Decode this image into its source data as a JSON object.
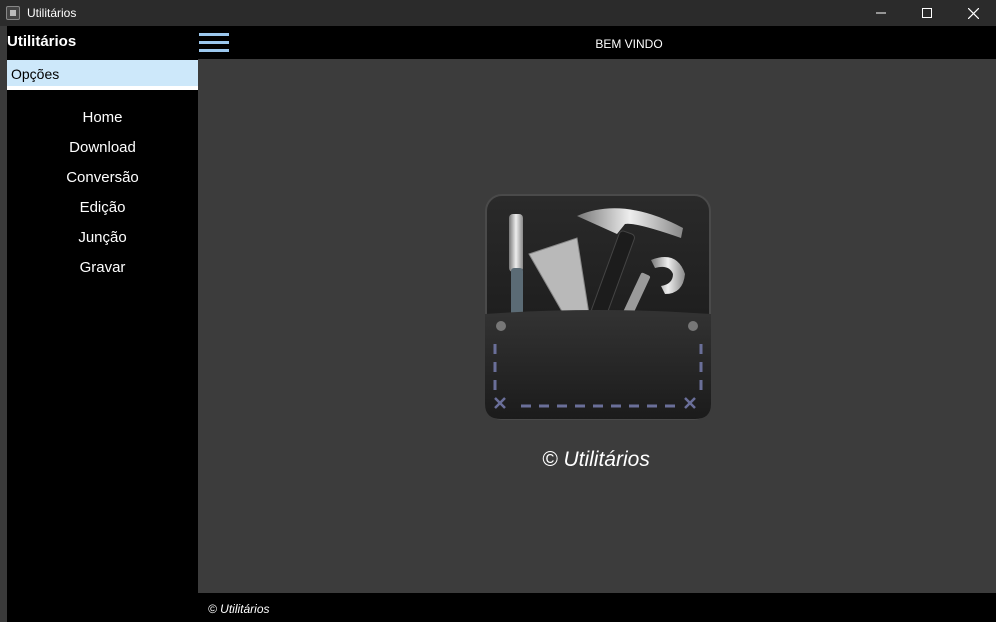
{
  "window": {
    "title": "Utilitários",
    "minimize_icon": "minimize-icon",
    "maximize_icon": "maximize-icon",
    "close_icon": "close-icon"
  },
  "sidebar": {
    "title": "Utilitários",
    "options_label": "Opções",
    "items": [
      {
        "label": "Home"
      },
      {
        "label": "Download"
      },
      {
        "label": "Conversão"
      },
      {
        "label": "Edição"
      },
      {
        "label": "Junção"
      },
      {
        "label": "Gravar"
      }
    ]
  },
  "header": {
    "menu_icon": "hamburger-menu-icon",
    "title": "BEM VINDO"
  },
  "main": {
    "logo_icon": "tools-pocket-logo-icon",
    "caption": "© Utilitários"
  },
  "footer": {
    "text": "© Utilitários"
  },
  "colors": {
    "accent": "#9cc8ee",
    "options_highlight": "#cde8fa",
    "content_bg": "#3c3c3c",
    "titlebar_bg": "#2b2b2b"
  }
}
